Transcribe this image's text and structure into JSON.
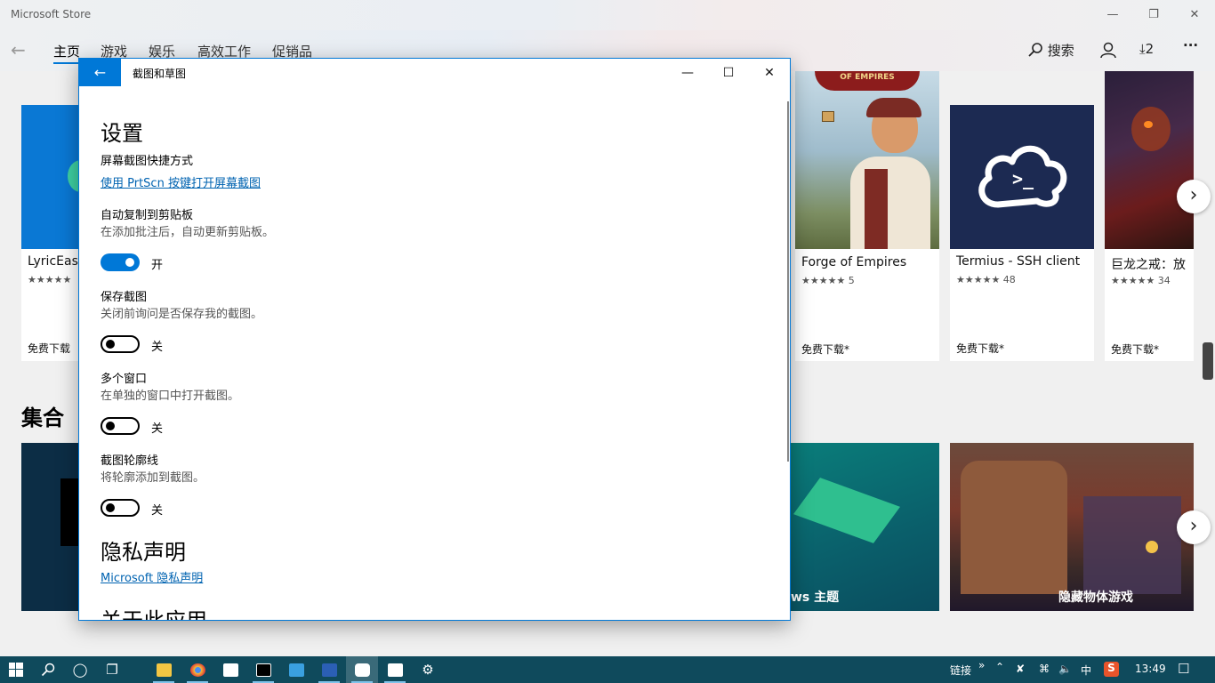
{
  "store": {
    "title": "Microsoft Store",
    "nav_tabs": [
      "主页",
      "游戏",
      "娱乐",
      "高效工作",
      "促销品"
    ],
    "search_label": "搜索",
    "downloads_count": "2",
    "more": "···"
  },
  "cards": [
    {
      "name": "LyricEase",
      "rating": "★★★★★",
      "price": "免费下载"
    },
    {
      "name": "Forge of Empires",
      "rating": "★★★★★ 5",
      "price": "免费下载*"
    },
    {
      "name": "Termius - SSH client",
      "rating": "★★★★★ 48",
      "price": "免费下载*"
    },
    {
      "name": "巨龙之戒：放",
      "rating": "★★★★★ 34",
      "price": "免费下载*"
    }
  ],
  "forge_banner": "OF EMPIRES",
  "collections": {
    "title": "集合",
    "items": [
      "ws 主题",
      "隐藏物体游戏"
    ]
  },
  "dialog": {
    "title": "截图和草图",
    "settings_heading": "设置",
    "shortcut_label": "屏幕截图快捷方式",
    "shortcut_link": "使用 PrtScn 按键打开屏幕截图",
    "autocopy_label": "自动复制到剪贴板",
    "autocopy_desc": "在添加批注后，自动更新剪贴板。",
    "autocopy_state": "开",
    "save_label": "保存截图",
    "save_desc": "关闭前询问是否保存我的截图。",
    "save_state": "关",
    "multi_label": "多个窗口",
    "multi_desc": "在单独的窗口中打开截图。",
    "multi_state": "关",
    "outline_label": "截图轮廓线",
    "outline_desc": "将轮廓添加到截图。",
    "outline_state": "关",
    "privacy_heading": "隐私声明",
    "privacy_link": "Microsoft 隐私声明",
    "about_heading": "关于此应用"
  },
  "toggles": {
    "autocopy": true,
    "save": false,
    "multi": false,
    "outline": false
  },
  "taskbar": {
    "links_label": "链接",
    "ime": "中",
    "clock": "13:49"
  }
}
